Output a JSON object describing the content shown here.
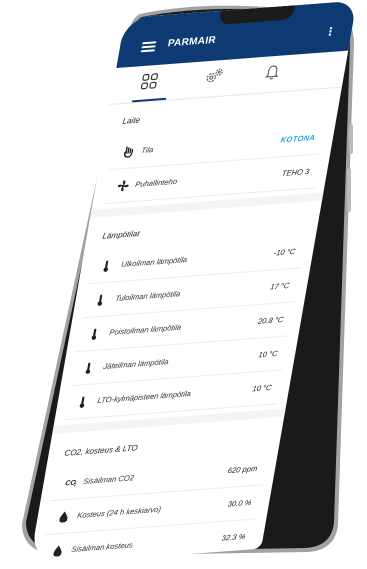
{
  "app": {
    "title": "PARMAIR"
  },
  "tabs": [
    {
      "name": "dashboard-icon",
      "active": true
    },
    {
      "name": "settings-icon",
      "active": false
    },
    {
      "name": "bell-icon",
      "active": false
    }
  ],
  "sections": {
    "laite": {
      "title": "Laite",
      "rows": [
        {
          "label": "Tila",
          "value": "KOTONA",
          "icon": "hand-icon"
        },
        {
          "label": "Puhallinteho",
          "value": "TEHO 3",
          "icon": "fan-icon"
        }
      ]
    },
    "lampotilat": {
      "title": "Lämpötilat",
      "rows": [
        {
          "label": "Ulkoilman lämpötila",
          "value": "-10 °C",
          "icon": "thermometer-icon"
        },
        {
          "label": "Tuloilman lämpötila",
          "value": "17 °C",
          "icon": "thermometer-icon"
        },
        {
          "label": "Poistoilman lämpötila",
          "value": "20.8 °C",
          "icon": "thermometer-icon"
        },
        {
          "label": "Jäteilman lämpötila",
          "value": "10 °C",
          "icon": "thermometer-icon"
        },
        {
          "label": "LTO-kylmäpisteen lämpötila",
          "value": "10 °C",
          "icon": "thermometer-icon"
        }
      ]
    },
    "co2": {
      "title": "CO2, kosteus & LTO",
      "rows": [
        {
          "label": "Sisäilman CO2",
          "value": "620 ppm",
          "icon": "co2-icon"
        },
        {
          "label": "Kosteus (24 h keskiarvo)",
          "value": "30.0 %",
          "icon": "drop-icon"
        },
        {
          "label": "Sisäilman kosteus",
          "value": "32.3 %",
          "icon": "drop-icon"
        }
      ]
    }
  },
  "colors": {
    "header": "#0d3a73",
    "accent": "#27a3e3"
  }
}
